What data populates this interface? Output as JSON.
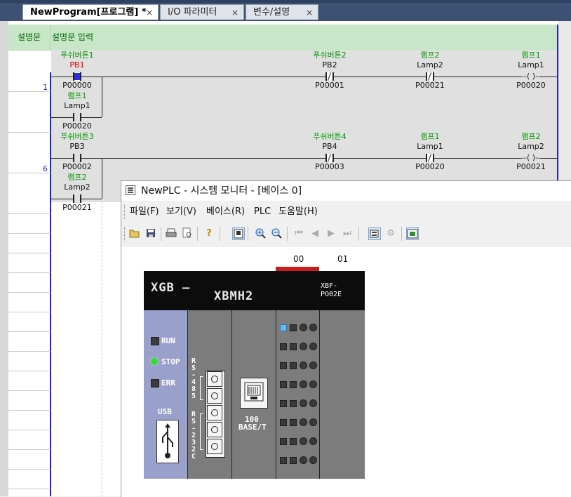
{
  "tabs": [
    {
      "label": "NewProgram[프로그램] *",
      "close": "×",
      "active": true
    },
    {
      "label": "I/O 파라미터",
      "close": "×",
      "active": false
    },
    {
      "label": "변수/설명",
      "close": "×",
      "active": false
    }
  ],
  "ladder": {
    "comment_label": "설명문",
    "comment_text": "설명문 입력",
    "rows": [
      {
        "number": "1"
      },
      {
        "number": "6"
      }
    ],
    "rung1": {
      "contacts": [
        {
          "comment": "푸쉬버튼1",
          "name": "PB1",
          "address": "P00000"
        },
        {
          "comment": "푸쉬버튼2",
          "name": "PB2",
          "address": "P00001"
        },
        {
          "comment": "램프2",
          "name": "Lamp2",
          "address": "P00021"
        }
      ],
      "coil": {
        "comment": "램프1",
        "name": "Lamp1",
        "address": "P00020",
        "symbol": "–( )–"
      },
      "parallel": {
        "comment": "램프1",
        "name": "Lamp1",
        "address": "P00020"
      }
    },
    "rung2": {
      "contacts": [
        {
          "comment": "푸쉬버튼3",
          "name": "PB3",
          "address": "P00002"
        },
        {
          "comment": "푸쉬버튼4",
          "name": "PB4",
          "address": "P00003"
        },
        {
          "comment": "램프1",
          "name": "Lamp1",
          "address": "P00020"
        }
      ],
      "coil": {
        "comment": "램프2",
        "name": "Lamp2",
        "address": "P00021",
        "symbol": "–( )–"
      },
      "parallel": {
        "comment": "램프2",
        "name": "Lamp2",
        "address": "P00021"
      }
    }
  },
  "system_monitor": {
    "title": "NewPLC - 시스템 모니터 - [베이스 0]",
    "menu": [
      "파일(F)",
      "보기(V)",
      "베이스(R)",
      "PLC",
      "도움말(H)"
    ],
    "toolbar_icons": [
      "open-icon",
      "save-icon",
      "print-icon",
      "print-preview-icon",
      "help-icon",
      "monitor-icon",
      "zoom-in-icon",
      "zoom-out-icon",
      "first-icon",
      "prev-icon",
      "next-icon",
      "last-icon",
      "module-info-icon",
      "io-sync-icon",
      "base-info-icon"
    ],
    "slots": [
      "00",
      "01"
    ],
    "plc": {
      "logo_line1": "XGB —",
      "logo_line2": "XBMH2",
      "io_module_label": "XBF-\nPO02E",
      "leds": [
        {
          "label": "RUN",
          "state": "off",
          "color": "#3b3b3b"
        },
        {
          "label": "STOP",
          "state": "on",
          "color": "#38d838"
        },
        {
          "label": "ERR",
          "state": "off",
          "color": "#3b3b3b"
        }
      ],
      "usb_label": "USB",
      "rs485_label": "RS-485",
      "rs232_label": "RS-232C",
      "ethernet_label_line1": "100",
      "ethernet_label_line2": "BASE/T"
    }
  }
}
